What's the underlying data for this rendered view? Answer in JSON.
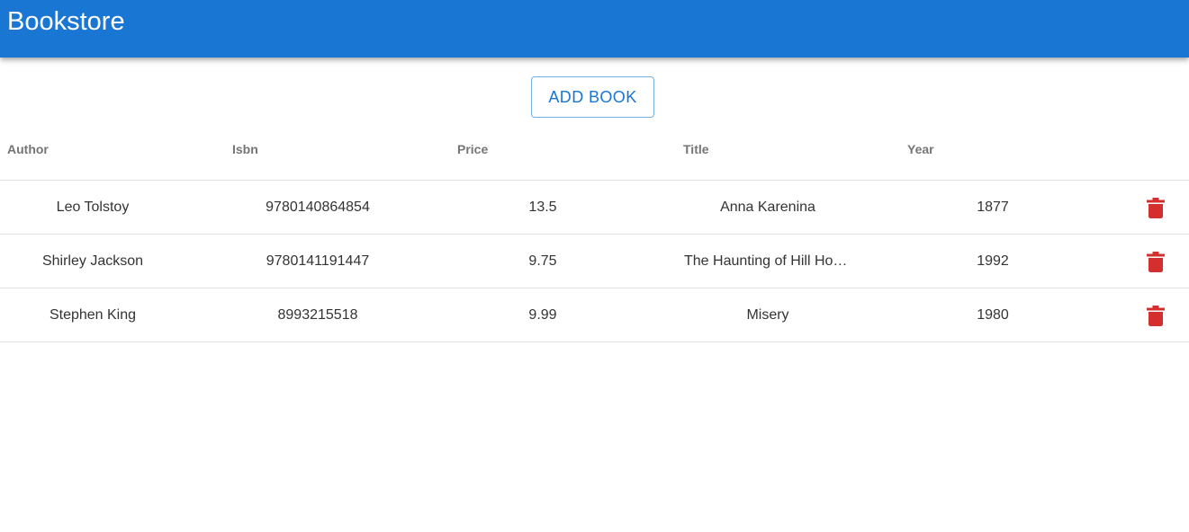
{
  "app": {
    "title": "Bookstore"
  },
  "toolbar": {
    "add_label": "ADD BOOK"
  },
  "colors": {
    "primary": "#1976d2",
    "delete": "#d32f2f"
  },
  "table": {
    "columns": [
      "Author",
      "Isbn",
      "Price",
      "Title",
      "Year"
    ],
    "rows": [
      {
        "author": "Leo Tolstoy",
        "isbn": "9780140864854",
        "price": "13.5",
        "title": "Anna Karenina",
        "year": "1877",
        "action_icon": "trash-icon"
      },
      {
        "author": "Shirley Jackson",
        "isbn": "9780141191447",
        "price": "9.75",
        "title": "The Haunting of Hill House",
        "year": "1992",
        "action_icon": "trash-icon"
      },
      {
        "author": "Stephen King",
        "isbn": "8993215518",
        "price": "9.99",
        "title": "Misery",
        "year": "1980",
        "action_icon": "trash-icon"
      }
    ]
  }
}
